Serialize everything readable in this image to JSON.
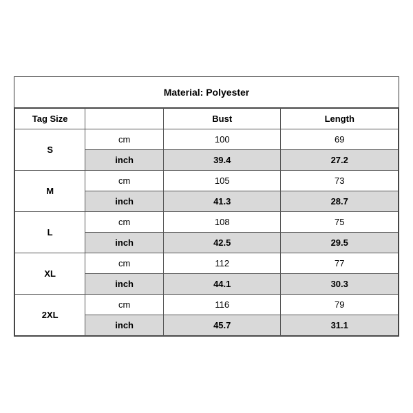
{
  "title": "Material: Polyester",
  "headers": {
    "tag_size": "Tag Size",
    "bust": "Bust",
    "length": "Length"
  },
  "rows": [
    {
      "size": "S",
      "cm_bust": "100",
      "cm_length": "69",
      "inch_bust": "39.4",
      "inch_length": "27.2"
    },
    {
      "size": "M",
      "cm_bust": "105",
      "cm_length": "73",
      "inch_bust": "41.3",
      "inch_length": "28.7"
    },
    {
      "size": "L",
      "cm_bust": "108",
      "cm_length": "75",
      "inch_bust": "42.5",
      "inch_length": "29.5"
    },
    {
      "size": "XL",
      "cm_bust": "112",
      "cm_length": "77",
      "inch_bust": "44.1",
      "inch_length": "30.3"
    },
    {
      "size": "2XL",
      "cm_bust": "116",
      "cm_length": "79",
      "inch_bust": "45.7",
      "inch_length": "31.1"
    }
  ],
  "units": {
    "cm": "cm",
    "inch": "inch"
  }
}
